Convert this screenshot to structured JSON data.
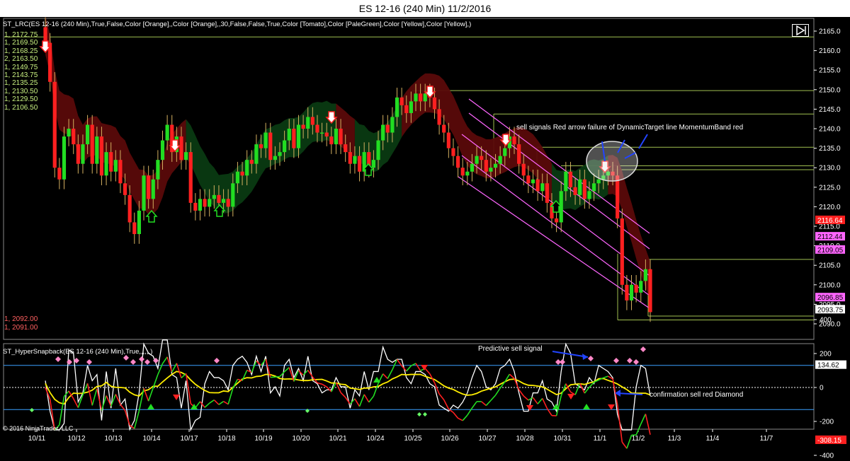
{
  "window": {
    "title": "ES 12-16 (240 Min)  11/2/2016"
  },
  "indicators": {
    "main": "ST_LRC(ES 12-16 (240 Min),True,False,Color [Orange],,Color [Orange],,30,False,False,True,Color [Tomato],Color [PaleGreen],Color [Yellow],Color [Yellow],)",
    "sub": "ST_HyperSnapback(ES 12-16 (240 Min),True,,,,,,)"
  },
  "level_list_top": [
    "1, 2172.75",
    "1, 2169.50",
    "1, 2168.25",
    "2, 2163.50",
    "1, 2149.75",
    "1, 2143.75",
    "1, 2135.25",
    "1, 2130.50",
    "1, 2129.50",
    "1, 2106.50"
  ],
  "level_list_bottom": [
    "1, 2092.00",
    "1, 2091.00"
  ],
  "annotations": {
    "sell_signals": "sell signals Red arrow failure of DynamicTarget line MomentumBand red",
    "predictive": "Predictive sell signal",
    "confirmation": "confirmation sell red Diamond"
  },
  "copyright": "© 2016 NinjaTrader, LLC",
  "colors": {
    "up": "#22dd22",
    "down": "#ff2020",
    "grid": "#a0c050",
    "band_red": "#5a0a0a",
    "band_green": "#0a3a12",
    "channel": "#ff66ff"
  },
  "chart_data": [
    {
      "type": "candlestick",
      "title": "ES 12-16 (240 Min)",
      "ylim": [
        2088,
        2168
      ],
      "y_ticks": [
        2090,
        2095,
        2100,
        2105,
        2110,
        2115,
        2120,
        2125,
        2130,
        2135,
        2140,
        2145,
        2150,
        2155,
        2160,
        2165
      ],
      "x_ticks": [
        "10/11",
        "10/12",
        "10/13",
        "10/14",
        "10/17",
        "10/18",
        "10/19",
        "10/20",
        "10/21",
        "10/24",
        "10/25",
        "10/26",
        "10/27",
        "10/28",
        "10/31",
        "11/1",
        "11/2",
        "11/3",
        "11/4",
        "11/7"
      ],
      "price_tags": [
        {
          "label": "2116.64",
          "value": 2116.64,
          "bg": "#ff2020",
          "fg": "#ffffff"
        },
        {
          "label": "2112.44",
          "value": 2112.44,
          "bg": "#ff66ff",
          "fg": "#000000"
        },
        {
          "label": "2109.05",
          "value": 2109.05,
          "bg": "#ff66ff",
          "fg": "#000000"
        },
        {
          "label": "2096.85",
          "value": 2096.85,
          "bg": "#ff66ff",
          "fg": "#000000"
        },
        {
          "label": "2093.75",
          "value": 2093.75,
          "bg": "#ffffff",
          "fg": "#000000"
        }
      ],
      "closes": [
        2162,
        2152,
        2130,
        2127,
        2138,
        2140,
        2136,
        2131,
        2136,
        2141,
        2131,
        2138,
        2128,
        2134,
        2129,
        2132,
        2126,
        2123,
        2116,
        2113,
        2119,
        2128,
        2122,
        2127,
        2132,
        2137,
        2141,
        2134,
        2138,
        2132,
        2134,
        2121,
        2119,
        2122,
        2120,
        2122,
        2123,
        2121,
        2122,
        2120,
        2126,
        2129,
        2128,
        2132,
        2131,
        2136,
        2135,
        2139,
        2132,
        2133,
        2134,
        2137,
        2140,
        2135,
        2141,
        2140,
        2143,
        2141,
        2139,
        2139,
        2138,
        2136,
        2140,
        2136,
        2134,
        2131,
        2133,
        2129,
        2134,
        2130,
        2132,
        2137,
        2141,
        2139,
        2143,
        2148,
        2146,
        2144,
        2147,
        2149,
        2147,
        2149,
        2148,
        2145,
        2141,
        2139,
        2135,
        2133,
        2130,
        2128,
        2129,
        2131,
        2133,
        2132,
        2129,
        2130,
        2131,
        2133,
        2135,
        2138,
        2136,
        2131,
        2128,
        2126,
        2127,
        2124,
        2126,
        2121,
        2117,
        2116,
        2124,
        2129,
        2125,
        2123,
        2127,
        2122,
        2124,
        2126,
        2127,
        2128,
        2129,
        2128,
        2117,
        2100,
        2096,
        2100,
        2098,
        2101,
        2104,
        2093
      ],
      "channel_lines_note": "descending regression channel from 10/26 to 11/2"
    },
    {
      "type": "line",
      "title": "ST_HyperSnapback",
      "ylim": [
        -450,
        450
      ],
      "y_ticks": [
        400,
        200,
        0,
        -200,
        -400
      ],
      "series": [],
      "price_tags": [
        {
          "label": "134.62",
          "value": 134.62,
          "bg": "#ffffff",
          "fg": "#000000"
        },
        {
          "label": "-308.15",
          "value": -308.15,
          "bg": "#ff2020",
          "fg": "#ffffff"
        }
      ]
    }
  ]
}
